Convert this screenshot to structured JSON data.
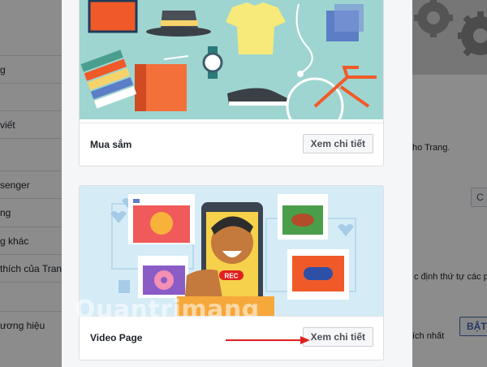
{
  "background": {
    "sidebar_items": [
      "g",
      "viết",
      "senger",
      "ng",
      "g khác",
      "thích của Tran",
      "ương hiệu"
    ],
    "right_texts": [
      "ho Trang.",
      "c định thứ tự các p",
      "ích nhất"
    ],
    "right_button": "C",
    "enable_button": "BẬT"
  },
  "cards": [
    {
      "title": "Mua sắm",
      "button": "Xem chi tiết"
    },
    {
      "title": "Video Page",
      "button": "Xem chi tiết",
      "rec_badge": "REC"
    }
  ],
  "watermark": "Quantrimang",
  "colors": {
    "shopping_bg": "#9fd5d0",
    "video_bg": "#d5ecf7",
    "annotation_arrow": "#e02020"
  }
}
